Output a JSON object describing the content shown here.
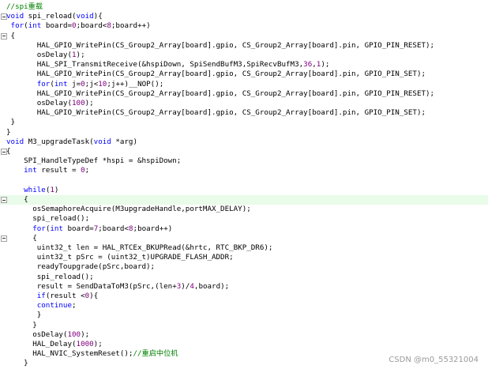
{
  "editor": {
    "lines": [
      {
        "indent": "",
        "tokens": [
          {
            "t": "//spi重载",
            "c": "cm"
          }
        ]
      },
      {
        "indent": "",
        "fold": true,
        "tokens": [
          {
            "t": "void",
            "c": "kw"
          },
          {
            "t": " spi_reload("
          },
          {
            "t": "void",
            "c": "kw"
          },
          {
            "t": "){"
          }
        ]
      },
      {
        "indent": " ",
        "tokens": [
          {
            "t": "for",
            "c": "kw"
          },
          {
            "t": "("
          },
          {
            "t": "int",
            "c": "kw"
          },
          {
            "t": " board="
          },
          {
            "t": "0",
            "c": "num"
          },
          {
            "t": ";board<"
          },
          {
            "t": "8",
            "c": "num"
          },
          {
            "t": ";board++)"
          }
        ]
      },
      {
        "indent": " ",
        "fold": true,
        "tokens": [
          {
            "t": "{"
          }
        ]
      },
      {
        "indent": "       ",
        "tokens": [
          {
            "t": "HAL_GPIO_WritePin(CS_Group2_Array[board].gpio, CS_Group2_Array[board].pin, GPIO_PIN_RESET);"
          }
        ]
      },
      {
        "indent": "       ",
        "tokens": [
          {
            "t": "osDelay("
          },
          {
            "t": "1",
            "c": "num"
          },
          {
            "t": ");"
          }
        ]
      },
      {
        "indent": "       ",
        "tokens": [
          {
            "t": "HAL_SPI_TransmitReceive(&hspiDown, SpiSendBufM3,SpiRecvBufM3,"
          },
          {
            "t": "36",
            "c": "num"
          },
          {
            "t": ","
          },
          {
            "t": "1",
            "c": "num"
          },
          {
            "t": ");"
          }
        ]
      },
      {
        "indent": "       ",
        "tokens": [
          {
            "t": "HAL_GPIO_WritePin(CS_Group2_Array[board].gpio, CS_Group2_Array[board].pin, GPIO_PIN_SET);"
          }
        ]
      },
      {
        "indent": "       ",
        "tokens": [
          {
            "t": "for",
            "c": "kw"
          },
          {
            "t": "("
          },
          {
            "t": "int",
            "c": "kw"
          },
          {
            "t": " j="
          },
          {
            "t": "0",
            "c": "num"
          },
          {
            "t": ";j<"
          },
          {
            "t": "10",
            "c": "num"
          },
          {
            "t": ";j++)__NOP();"
          }
        ]
      },
      {
        "indent": "       ",
        "tokens": [
          {
            "t": "HAL_GPIO_WritePin(CS_Group2_Array[board].gpio, CS_Group2_Array[board].pin, GPIO_PIN_RESET);"
          }
        ]
      },
      {
        "indent": "       ",
        "tokens": [
          {
            "t": "osDelay("
          },
          {
            "t": "100",
            "c": "num"
          },
          {
            "t": ");"
          }
        ]
      },
      {
        "indent": "       ",
        "tokens": [
          {
            "t": "HAL_GPIO_WritePin(CS_Group2_Array[board].gpio, CS_Group2_Array[board].pin, GPIO_PIN_SET);"
          }
        ]
      },
      {
        "indent": " ",
        "tokens": [
          {
            "t": "}"
          }
        ]
      },
      {
        "indent": "",
        "tokens": [
          {
            "t": "}"
          }
        ]
      },
      {
        "indent": "",
        "tokens": [
          {
            "t": "void",
            "c": "kw"
          },
          {
            "t": " M3_upgradeTask("
          },
          {
            "t": "void",
            "c": "kw"
          },
          {
            "t": " *arg)"
          }
        ]
      },
      {
        "indent": "",
        "fold": true,
        "tokens": [
          {
            "t": "{"
          }
        ]
      },
      {
        "indent": "    ",
        "tokens": [
          {
            "t": "SPI_HandleTypeDef *hspi = &hspiDown;"
          }
        ]
      },
      {
        "indent": "    ",
        "tokens": [
          {
            "t": "int",
            "c": "kw"
          },
          {
            "t": " result = "
          },
          {
            "t": "0",
            "c": "num"
          },
          {
            "t": ";"
          }
        ]
      },
      {
        "indent": "",
        "tokens": []
      },
      {
        "indent": "    ",
        "tokens": [
          {
            "t": "while",
            "c": "kw"
          },
          {
            "t": "("
          },
          {
            "t": "1",
            "c": "num"
          },
          {
            "t": ")"
          }
        ]
      },
      {
        "indent": "    ",
        "fold": true,
        "hl": true,
        "tokens": [
          {
            "t": "{"
          }
        ]
      },
      {
        "indent": "      ",
        "tokens": [
          {
            "t": "osSemaphoreAcquire(M3upgradeHandle,portMAX_DELAY);"
          }
        ]
      },
      {
        "indent": "      ",
        "tokens": [
          {
            "t": "spi_reload();"
          }
        ]
      },
      {
        "indent": "      ",
        "tokens": [
          {
            "t": "for",
            "c": "kw"
          },
          {
            "t": "("
          },
          {
            "t": "int",
            "c": "kw"
          },
          {
            "t": " board="
          },
          {
            "t": "7",
            "c": "num"
          },
          {
            "t": ";board<"
          },
          {
            "t": "8",
            "c": "num"
          },
          {
            "t": ";board++)"
          }
        ]
      },
      {
        "indent": "      ",
        "fold": true,
        "tokens": [
          {
            "t": "{"
          }
        ]
      },
      {
        "indent": "       ",
        "tokens": [
          {
            "t": "uint32_t len = HAL_RTCEx_BKUPRead(&hrtc, RTC_BKP_DR6);"
          }
        ]
      },
      {
        "indent": "       ",
        "tokens": [
          {
            "t": "uint32_t pSrc = (uint32_t)UPGRADE_FLASH_ADDR;"
          }
        ]
      },
      {
        "indent": "       ",
        "tokens": [
          {
            "t": "readyToupgrade(pSrc,board);"
          }
        ]
      },
      {
        "indent": "       ",
        "tokens": [
          {
            "t": "spi_reload();"
          }
        ]
      },
      {
        "indent": "       ",
        "tokens": [
          {
            "t": "result = SendDataToM3(pSrc,(len+"
          },
          {
            "t": "3",
            "c": "num"
          },
          {
            "t": ")/"
          },
          {
            "t": "4",
            "c": "num"
          },
          {
            "t": ",board);"
          }
        ]
      },
      {
        "indent": "       ",
        "tokens": [
          {
            "t": "if",
            "c": "kw"
          },
          {
            "t": "(result <"
          },
          {
            "t": "0",
            "c": "num"
          },
          {
            "t": "){"
          }
        ]
      },
      {
        "indent": "       ",
        "tokens": [
          {
            "t": "continue",
            "c": "kw"
          },
          {
            "t": ";"
          }
        ]
      },
      {
        "indent": "       ",
        "tokens": [
          {
            "t": "}"
          }
        ]
      },
      {
        "indent": "      ",
        "tokens": [
          {
            "t": "}"
          }
        ]
      },
      {
        "indent": "      ",
        "tokens": [
          {
            "t": "osDelay("
          },
          {
            "t": "100",
            "c": "num"
          },
          {
            "t": ");"
          }
        ]
      },
      {
        "indent": "      ",
        "tokens": [
          {
            "t": "HAL_Delay("
          },
          {
            "t": "1000",
            "c": "num"
          },
          {
            "t": ");"
          }
        ]
      },
      {
        "indent": "      ",
        "tokens": [
          {
            "t": "HAL_NVIC_SystemReset();"
          },
          {
            "t": "//重启中位机",
            "c": "cm"
          }
        ]
      },
      {
        "indent": "    ",
        "tokens": [
          {
            "t": "}"
          }
        ]
      }
    ]
  },
  "watermark": {
    "text": "CSDN @m0_55321004"
  },
  "colors": {
    "keyword": "#0000ff",
    "comment": "#008000",
    "number": "#800080",
    "highlight": "#e9fbe9"
  }
}
